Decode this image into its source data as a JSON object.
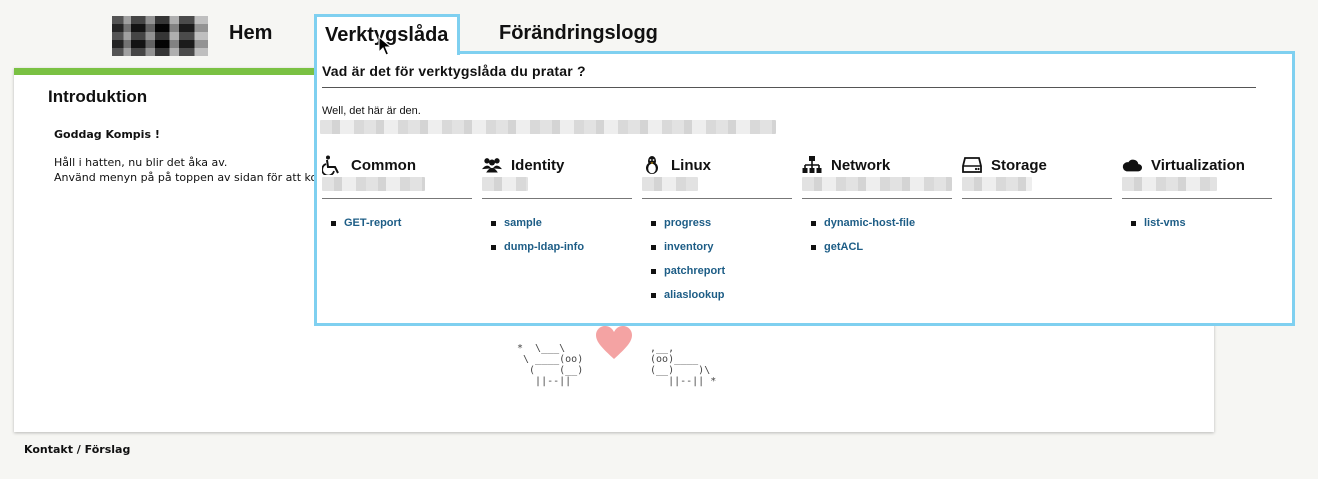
{
  "header": {
    "nav": [
      "Hem",
      "Verktygslåda",
      "Förändringslogg"
    ]
  },
  "intro": {
    "title": "Introduktion",
    "greeting": "Goddag Kompis !",
    "line1": "Håll i hatten, nu blir det åka av.",
    "line2": "Använd menyn på på toppen av sidan för att komm"
  },
  "ascii": {
    "left": "*  \\___\\\n \\ ____(oo)\n  (    (__)\n   ||--||",
    "right": " ,__,\n (oo)____\n (__)    )\\\n    ||--|| *"
  },
  "dropdown": {
    "title": "Vad är det för verktygslåda du pratar ?",
    "intro": "Well, det här är den.",
    "columns": [
      {
        "title": "Common",
        "icon": "wheelchair-icon",
        "items": [
          "GET-report"
        ]
      },
      {
        "title": "Identity",
        "icon": "users-icon",
        "items": [
          "sample",
          "dump-ldap-info"
        ]
      },
      {
        "title": "Linux",
        "icon": "linux-tux-icon",
        "items": [
          "progress",
          "inventory",
          "patchreport",
          "aliaslookup"
        ]
      },
      {
        "title": "Network",
        "icon": "network-sitemap-icon",
        "items": [
          "dynamic-host-file",
          "getACL"
        ]
      },
      {
        "title": "Storage",
        "icon": "hard-drive-icon",
        "items": []
      },
      {
        "title": "Virtualization",
        "icon": "cloud-icon",
        "items": [
          "list-vms"
        ]
      }
    ]
  },
  "footer": {
    "text": "Kontakt / Förslag"
  },
  "colors": {
    "accent_green": "#7ac143",
    "menu_border": "#7fd0f0",
    "link": "#1d5d86",
    "heart": "#f4a3a3"
  }
}
